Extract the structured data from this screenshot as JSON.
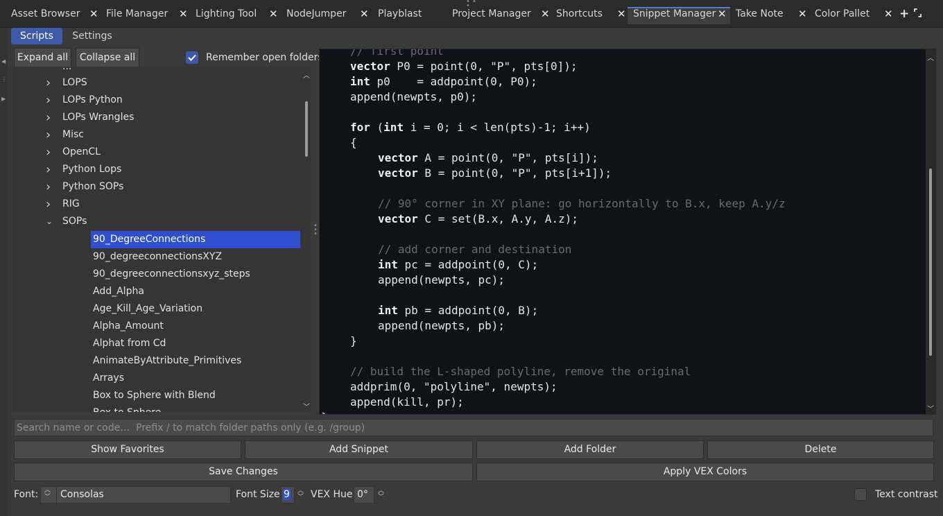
{
  "tabs": [
    {
      "label": "Asset Browser",
      "active": false
    },
    {
      "label": "File Manager",
      "active": false
    },
    {
      "label": "Lighting Tool",
      "active": false
    },
    {
      "label": "NodeJumper",
      "active": false
    },
    {
      "label": "Playblast",
      "active": false
    },
    {
      "label": "Project Manager",
      "active": false
    },
    {
      "label": "Shortcuts",
      "active": false
    },
    {
      "label": "Snippet Manager",
      "active": true
    },
    {
      "label": "Take Note",
      "active": false
    },
    {
      "label": "Color Pallet",
      "active": false
    }
  ],
  "tab_close_glyph": "✕",
  "tab_toolbar": {
    "add_glyph": "+",
    "float_glyph": "⌜⌟"
  },
  "subtabs": {
    "scripts": "Scripts",
    "settings": "Settings"
  },
  "tree_toolbar": {
    "expand_all": "Expand all",
    "collapse_all": "Collapse all",
    "remember_open_folders": "Remember open folders",
    "remember_checked": true
  },
  "tree": {
    "partial_top": "...",
    "folders": [
      "LOPS",
      "LOPs Python",
      "LOPs Wrangles",
      "Misc",
      "OpenCL",
      "Python Lops",
      "Python SOPs",
      "RIG"
    ],
    "open_folder": "SOPs",
    "items": [
      "90_DegreeConnections",
      "90_degreeconnectionsXYZ",
      "90_degreeconnectionsxyz_steps",
      "Add_Alpha",
      "Age_Kill_Age_Variation",
      "Alpha_Amount",
      "Alphat from Cd",
      "AnimateByAttribute_Primitives",
      "Arrays",
      "Box to Sphere with Blend",
      "Box to Sphere"
    ],
    "selected_item": "90_DegreeConnections"
  },
  "code": {
    "lines": [
      {
        "text": "// first point",
        "kind": "comment",
        "indent": 0
      },
      {
        "kw": "vector",
        "text": " P0 = point(0, \"P\", pts[0]);",
        "indent": 0
      },
      {
        "kw": "int",
        "text": " p0    = addpoint(0, P0);",
        "indent": 0
      },
      {
        "text": "append(newpts, p0);",
        "indent": 0
      },
      {
        "text": "",
        "indent": 0
      },
      {
        "kw": "for",
        "text": " (",
        "kw2": "int",
        "text2": " i = 0; i < len(pts)-1; i++)",
        "indent": 0
      },
      {
        "text": "{",
        "indent": 0
      },
      {
        "kw": "vector",
        "text": " A = point(0, \"P\", pts[i]);",
        "indent": 1
      },
      {
        "kw": "vector",
        "text": " B = point(0, \"P\", pts[i+1]);",
        "indent": 1
      },
      {
        "text": "",
        "indent": 1
      },
      {
        "text": "// 90° corner in XY plane: go horizontally to B.x, keep A.y/z",
        "kind": "comment",
        "indent": 1
      },
      {
        "kw": "vector",
        "text": " C = set(B.x, A.y, A.z);",
        "indent": 1
      },
      {
        "text": "",
        "indent": 1
      },
      {
        "text": "// add corner and destination",
        "kind": "comment",
        "indent": 1
      },
      {
        "kw": "int",
        "text": " pc = addpoint(0, C);",
        "indent": 1
      },
      {
        "text": "append(newpts, pc);",
        "indent": 1
      },
      {
        "text": "",
        "indent": 1
      },
      {
        "kw": "int",
        "text": " pb = addpoint(0, B);",
        "indent": 1
      },
      {
        "text": "append(newpts, pb);",
        "indent": 1
      },
      {
        "text": "}",
        "indent": 0
      },
      {
        "text": "",
        "indent": 0
      },
      {
        "text": "// build the L-shaped polyline, remove the original",
        "kind": "comment",
        "indent": 0
      },
      {
        "text": "addprim(0, \"polyline\", newpts);",
        "indent": 0
      },
      {
        "text": "append(kill, pr);",
        "indent": 0
      },
      {
        "text": "}",
        "indent": -1
      }
    ]
  },
  "search": {
    "placeholder": "Search name or code…  Prefix / to match folder paths only (e.g. /group)",
    "value": ""
  },
  "actions": {
    "show_favorites": "Show Favorites",
    "add_snippet": "Add Snippet",
    "add_folder": "Add Folder",
    "delete": "Delete",
    "save_changes": "Save Changes",
    "apply_vex_colors": "Apply VEX Colors"
  },
  "footer": {
    "font_label": "Font:",
    "font_value": "Consolas",
    "font_size_label": "Font Size:",
    "font_size_value": "9",
    "vex_hue_label": "VEX Hue:",
    "vex_hue_value": "0°",
    "text_contrast_label": "Text contrast",
    "text_contrast_checked": false
  },
  "colors": {
    "accent": "#3e5aa6",
    "selection": "#2f4fd0",
    "editor_bg": "#0f1219"
  }
}
